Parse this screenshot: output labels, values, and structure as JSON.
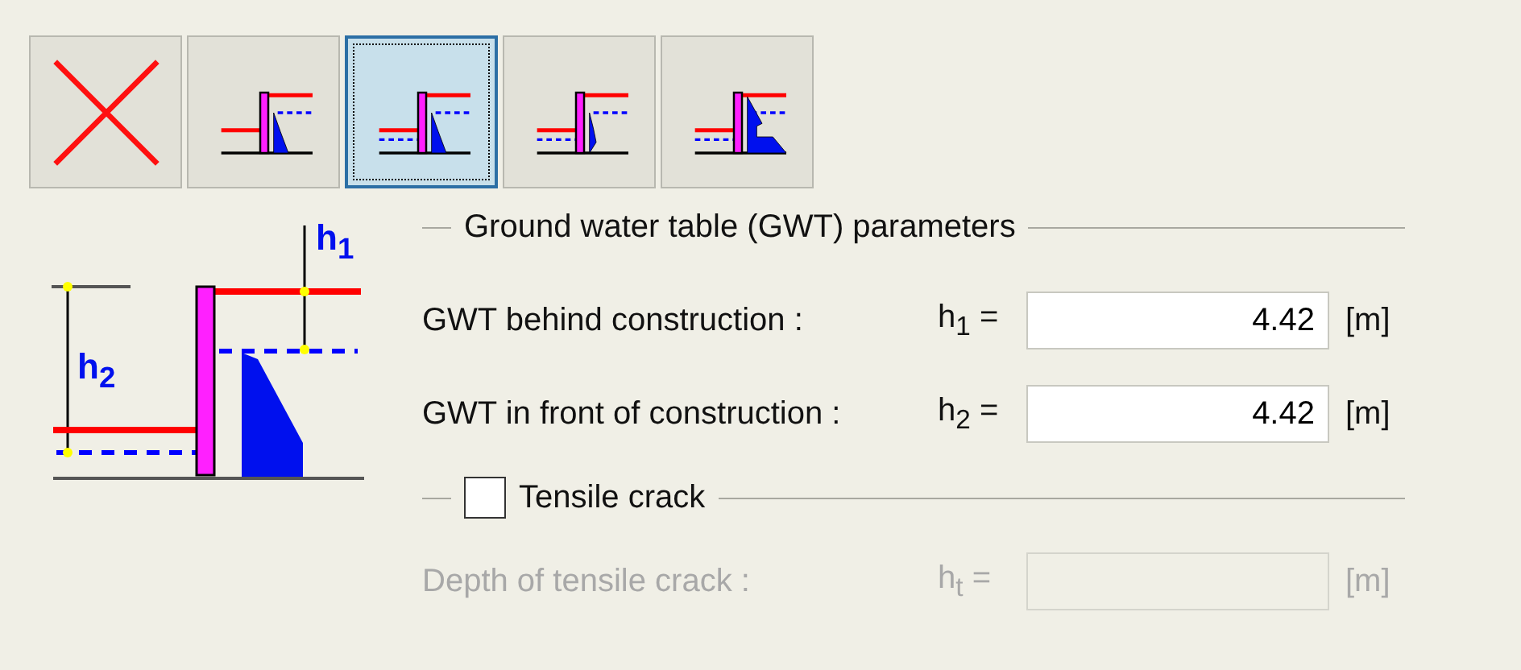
{
  "toolbar": [
    {
      "kind": "none",
      "selected": false
    },
    {
      "kind": "behind",
      "selected": false
    },
    {
      "kind": "both",
      "selected": true
    },
    {
      "kind": "both-reduced",
      "selected": false
    },
    {
      "kind": "both-flow",
      "selected": false
    }
  ],
  "diagram": {
    "labels": [
      "h$_{1}$",
      "h$_{2}$"
    ]
  },
  "gwt_group": {
    "title": "Ground water table (GWT) parameters",
    "fields": [
      {
        "label": "GWT behind construction :",
        "symbol": "h$_{1}$ =",
        "value": "4.42",
        "unit": "[m]",
        "disabled": false
      },
      {
        "label": "GWT in front of construction :",
        "symbol": "h$_{2}$ =",
        "value": "4.42",
        "unit": "[m]",
        "disabled": false
      }
    ]
  },
  "tensile_crack": {
    "label": "Tensile crack",
    "checked": false,
    "field": {
      "label": "Depth of tensile crack :",
      "symbol": "h$_{t}$ =",
      "unit": "[m]",
      "disabled": true
    }
  }
}
